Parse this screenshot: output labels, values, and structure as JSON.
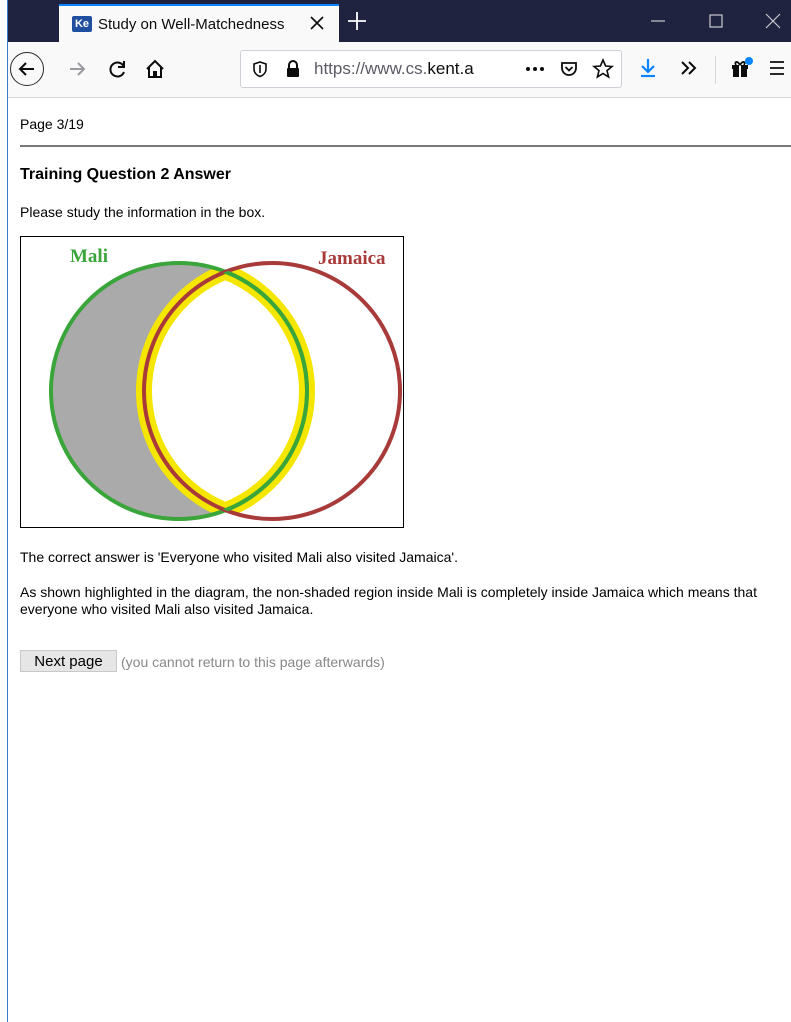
{
  "browser": {
    "tab_title": "Study on Well-Matchedness",
    "favicon_text": "Ke",
    "url_prefix": "https://www.cs.",
    "url_domain": "kent.a"
  },
  "page": {
    "page_indicator": "Page 3/19",
    "heading": "Training Question 2 Answer",
    "instruction": "Please study the information in the box.",
    "answer_text": "The correct answer is 'Everyone who visited Mali also visited Jamaica'.",
    "explanation": "As shown highlighted in the diagram, the non-shaded region inside Mali is completely inside Jamaica which means that everyone who visited Mali also visited Jamaica.",
    "next_button_label": "Next page",
    "next_note": "(you cannot return to this page afterwards)"
  },
  "diagram": {
    "left_label": "Mali",
    "right_label": "Jamaica",
    "left_color": "#3aa53a",
    "right_color": "#a83a3a",
    "shade_color": "#aaaaaa",
    "highlight_color": "#f5e600"
  }
}
